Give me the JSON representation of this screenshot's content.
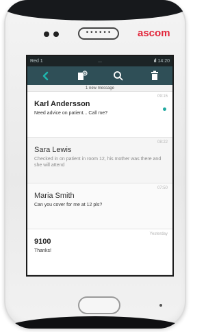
{
  "device": {
    "brand": "ascom",
    "speaker_glyph": "••••••"
  },
  "statusbar": {
    "carrier": "Red 1",
    "center": "...",
    "time": "14:20",
    "signal_glyph": "ıl"
  },
  "toolbar": {
    "icons": [
      "back-chevron-icon",
      "new-message-icon",
      "search-icon",
      "trash-icon"
    ],
    "accent_color": "#1fb5ad",
    "bar_color": "#2f4f57"
  },
  "banner": {
    "text": "1 new message"
  },
  "messages": [
    {
      "time": "09:15",
      "name": "Karl Andersson",
      "text": "Need advice on patient... Call me?",
      "unread": true
    },
    {
      "time": "08:22",
      "name": "Sara Lewis",
      "text": "Checked in on patient in room 12, his mother was there and she will attend",
      "unread": false
    },
    {
      "time": "07:50",
      "name": "Maria Smith",
      "text": "Can you cover for me at 12 pls?",
      "unread": false
    },
    {
      "time": "Yesterday",
      "name": "9100",
      "text": "Thanks!",
      "unread": false
    }
  ]
}
